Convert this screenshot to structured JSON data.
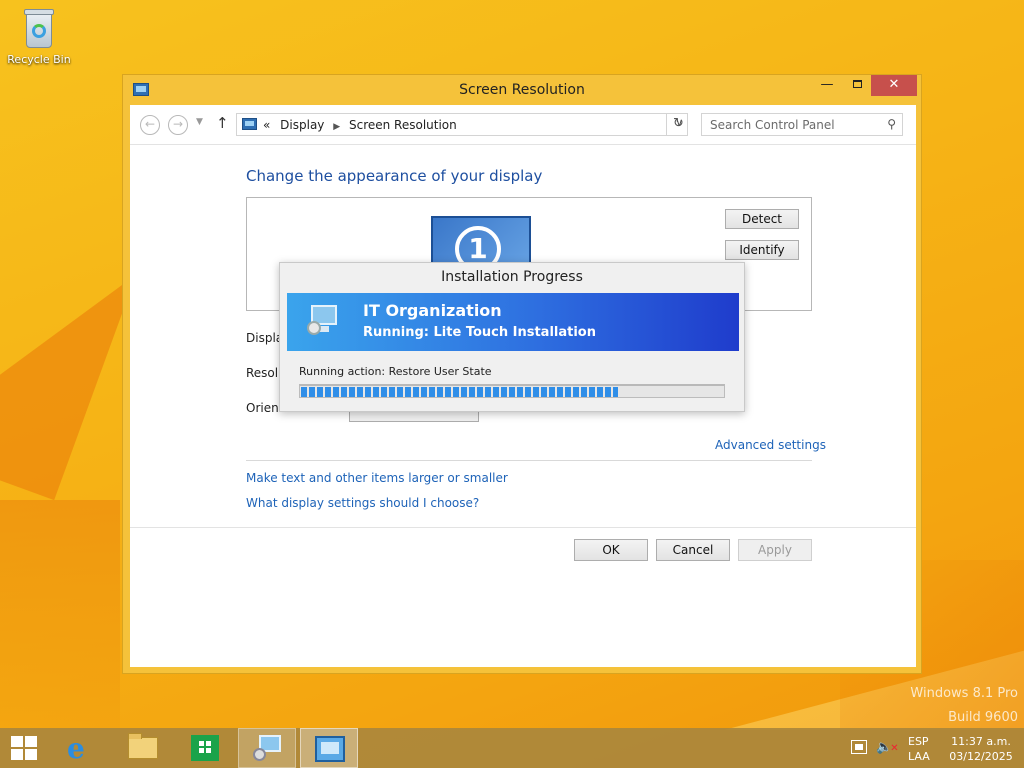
{
  "desktop": {
    "recycle_bin_label": "Recycle Bin",
    "watermark_line1": "Windows 8.1 Pro",
    "watermark_line2": "Build 9600"
  },
  "window": {
    "title": "Screen Resolution",
    "minimize": "—",
    "close": "✕",
    "nav": {
      "back": "←",
      "forward": "→",
      "up": "↑",
      "breadcrumb_chevron": "«",
      "breadcrumb": [
        "Display",
        "Screen Resolution"
      ],
      "search_placeholder": "Search Control Panel"
    },
    "heading": "Change the appearance of your display",
    "monitor_number": "1",
    "detect_label": "Detect",
    "identify_label": "Identify",
    "rows": {
      "display_label": "Display",
      "resolution_label": "Resolu",
      "orientation_label": "Orient"
    },
    "advanced_settings": "Advanced settings",
    "link_text_size": "Make text and other items larger or smaller",
    "link_help": "What display settings should I choose?",
    "ok_label": "OK",
    "cancel_label": "Cancel",
    "apply_label": "Apply"
  },
  "progress_dialog": {
    "title": "Installation Progress",
    "organization": "IT Organization",
    "status": "Running: Lite Touch Installation",
    "action": "Running action: Restore User State",
    "progress_fraction": 0.75
  },
  "taskbar": {
    "language_line1": "ESP",
    "language_line2": "LAA",
    "time": "11:37 a.m.",
    "date": "03/12/2025"
  },
  "colors": {
    "desktop_bg": "#f6b416",
    "window_frame": "#f5c23a",
    "link_blue": "#1e63b8",
    "banner_start": "#3aa4ec",
    "banner_end": "#1f3ccc",
    "close_button": "#c7504c"
  },
  "icons": {
    "recycle_bin": "recycle-bin-icon",
    "start": "windows-logo-icon",
    "ie": "internet-explorer-icon",
    "explorer": "file-explorer-icon",
    "store": "store-icon",
    "deployment": "deployment-icon",
    "control_panel": "control-panel-icon"
  }
}
